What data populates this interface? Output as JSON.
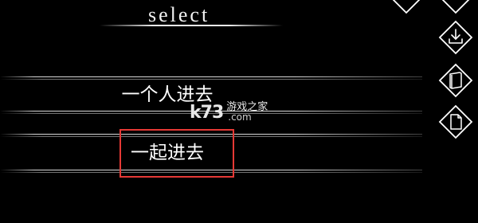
{
  "screen": {
    "title": "select"
  },
  "choices": [
    {
      "label": "一个人进去"
    },
    {
      "label": "一起进去"
    }
  ],
  "watermark": {
    "logo": "k73",
    "text": "游戏之家",
    "domain": ".com"
  },
  "side_buttons": [
    {
      "icon": "download-icon"
    },
    {
      "icon": "book-icon"
    },
    {
      "icon": "document-icon"
    }
  ],
  "colors": {
    "background": "#000000",
    "text": "#ffffff",
    "highlight": "#e53935"
  }
}
